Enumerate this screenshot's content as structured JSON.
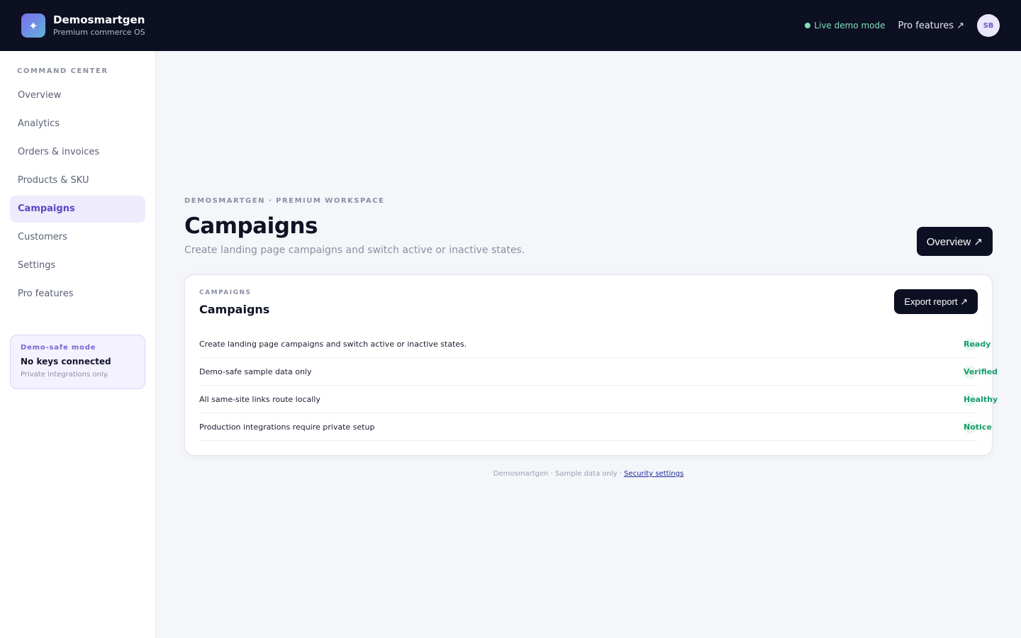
{
  "header": {
    "logo_glyph": "✦",
    "brand_name": "Demosmartgen",
    "brand_sub": "Premium commerce OS",
    "live_label": "Live demo mode",
    "pro_link": "Pro features ↗",
    "avatar_initials": "SB"
  },
  "sidebar": {
    "section_label": "COMMAND CENTER",
    "items": [
      {
        "label": "Overview"
      },
      {
        "label": "Analytics"
      },
      {
        "label": "Orders & invoices"
      },
      {
        "label": "Products & SKU"
      },
      {
        "label": "Campaigns",
        "active": true
      },
      {
        "label": "Customers"
      },
      {
        "label": "Settings"
      },
      {
        "label": "Pro features"
      }
    ],
    "demo_card": {
      "title": "Demo-safe mode",
      "heading": "No keys connected",
      "text": "Private integrations only."
    }
  },
  "main": {
    "eyebrow": "DEMOSMARTGEN · PREMIUM WORKSPACE",
    "title": "Campaigns",
    "subtitle": "Create landing page campaigns and switch active or inactive states.",
    "overview_button": "Overview ↗",
    "card": {
      "eyebrow": "CAMPAIGNS",
      "title": "Campaigns",
      "export_button": "Export report ↗",
      "rows": [
        {
          "text": "Create landing page campaigns and switch active or inactive states.",
          "status": "Ready"
        },
        {
          "text": "Demo-safe sample data only",
          "status": "Verified"
        },
        {
          "text": "All same-site links route locally",
          "status": "Healthy"
        },
        {
          "text": "Production integrations require private setup",
          "status": "Notice"
        }
      ]
    },
    "footer": {
      "text": "Demosmartgen · Sample data only ·",
      "link": "Security settings"
    }
  },
  "colors": {
    "topbar": "#0d1022",
    "accent": "#5a48c4",
    "status_green": "#1a9d6b"
  }
}
